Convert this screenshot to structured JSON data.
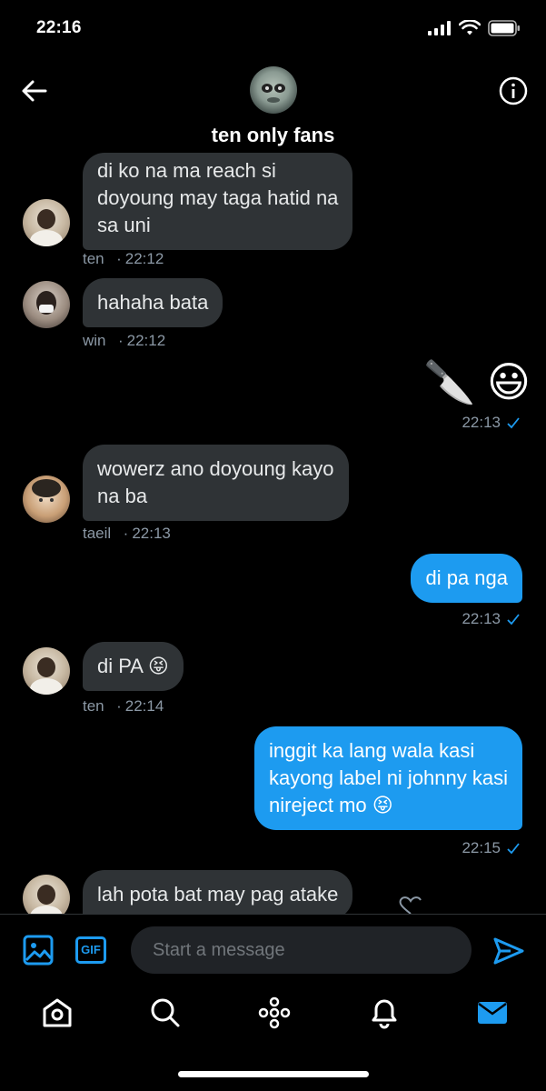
{
  "status_bar": {
    "time": "22:16"
  },
  "header": {
    "title": "ten only fans"
  },
  "messages": [
    {
      "sender": "ten",
      "time": "22:12",
      "lines": [
        "di ko na ma reach si",
        "doyoung may taga hatid na",
        "sa uni"
      ]
    },
    {
      "sender": "win",
      "time": "22:12",
      "lines": [
        "hahaha bata"
      ]
    },
    {
      "sender": "me",
      "time": "22:13",
      "emoji": "🔪 😃"
    },
    {
      "sender": "taeil",
      "time": "22:13",
      "lines": [
        "wowerz ano doyoung kayo",
        "na ba"
      ]
    },
    {
      "sender": "me",
      "time": "22:13",
      "lines": [
        "di pa nga"
      ]
    },
    {
      "sender": "ten",
      "time": "22:14",
      "lines": [
        "di PA 😝"
      ]
    },
    {
      "sender": "me",
      "time": "22:15",
      "lines": [
        "inggit ka lang wala kasi",
        "kayong label ni johnny kasi",
        "nireject mo 😝"
      ]
    },
    {
      "sender": "ten",
      "lines": [
        "lah pota bat may pag atake"
      ]
    }
  ],
  "composer": {
    "placeholder": "Start a message",
    "gif_label": "GIF"
  },
  "colors": {
    "accent": "#1d9bf0",
    "incoming_bubble": "#2f3336",
    "background": "#000000"
  },
  "nav_icons": [
    "home-icon",
    "search-icon",
    "spaces-icon",
    "notifications-icon",
    "messages-icon"
  ]
}
